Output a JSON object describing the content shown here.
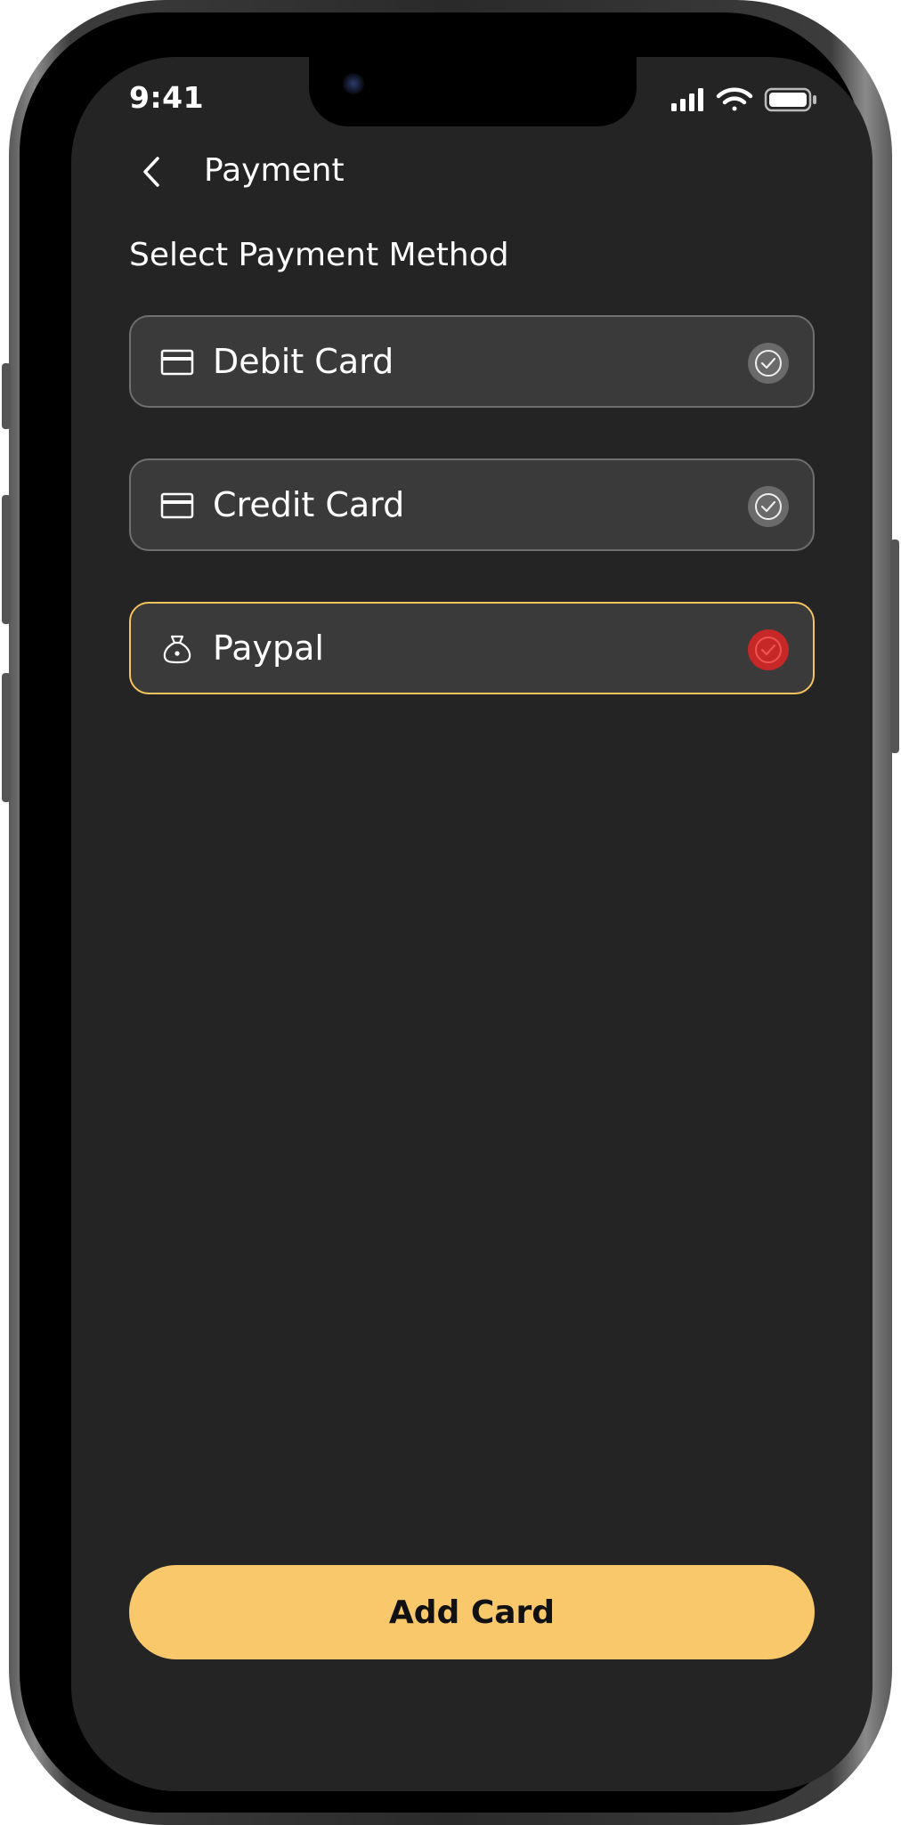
{
  "status_bar": {
    "time": "9:41"
  },
  "header": {
    "title": "Payment"
  },
  "section": {
    "title": "Select Payment Method"
  },
  "payment_methods": [
    {
      "label": "Debit Card",
      "icon": "credit-card-icon",
      "selected": false
    },
    {
      "label": "Credit Card",
      "icon": "credit-card-icon",
      "selected": false
    },
    {
      "label": "Paypal",
      "icon": "money-bag-icon",
      "selected": true
    }
  ],
  "actions": {
    "add_card_label": "Add Card"
  },
  "colors": {
    "background": "#242424",
    "card": "#3a3a3a",
    "card_border": "#6f6f6f",
    "accent": "#f8c86a",
    "selected_border": "#f6c35d",
    "selected_check": "#c62828"
  }
}
